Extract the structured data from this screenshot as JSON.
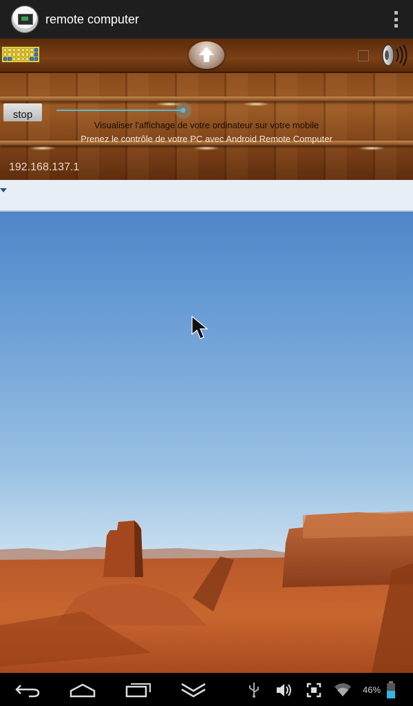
{
  "action_bar": {
    "title": "remote computer",
    "icons": [
      "app-icon",
      "overflow-menu-icon"
    ]
  },
  "control_panel": {
    "toolbar_icons": [
      "keyboard-icon",
      "upload-arrow-icon",
      "checkbox",
      "speaker-icon"
    ],
    "info_line_1": "Visualiser l'affichage de votre ordinateur sur votre mobile",
    "stop_button_label": "stop",
    "info_line_2": "Prenez le contrôle de votre PC avec Android Remote Computer",
    "ip_address": "192.168.137.1"
  },
  "remote_view": {
    "content": "desert-landscape-wallpaper",
    "cursor_icon": "mouse-pointer-icon"
  },
  "nav_bar": {
    "buttons": [
      "back-icon",
      "home-icon",
      "recent-apps-icon",
      "hide-keyboard-icon"
    ],
    "status_icons": [
      "usb-icon",
      "volume-icon",
      "screenshot-icon",
      "wifi-icon",
      "battery-icon"
    ],
    "battery_percent": "46%"
  },
  "colors": {
    "action_bar": "#1e1e1e",
    "wood": "#8a4b1c",
    "slider_accent": "#5fb6d4",
    "battery": "#33b5e5"
  }
}
